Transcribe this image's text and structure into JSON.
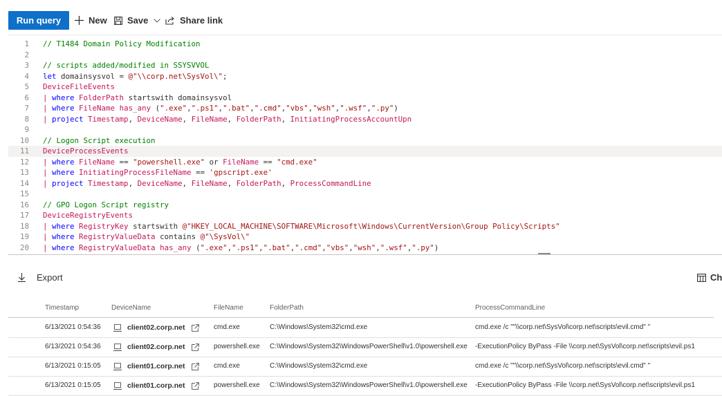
{
  "toolbar": {
    "run_label": "Run query",
    "new_label": "New",
    "save_label": "Save",
    "share_label": "Share link"
  },
  "editor": {
    "lines": [
      {
        "n": "1",
        "tokens": [
          [
            "c",
            "// T1484 Domain Policy Modification"
          ]
        ]
      },
      {
        "n": "2",
        "tokens": []
      },
      {
        "n": "3",
        "tokens": [
          [
            "c",
            "// scripts added/modified in SSYSVVOL"
          ]
        ]
      },
      {
        "n": "4",
        "tokens": [
          [
            "k",
            "let"
          ],
          [
            "o",
            " domainsysvol = "
          ],
          [
            "s",
            "@\"\\\\corp.net\\SysVol\\\""
          ],
          [
            "o",
            ";"
          ]
        ]
      },
      {
        "n": "5",
        "tokens": [
          [
            "t",
            "DeviceFileEvents"
          ]
        ]
      },
      {
        "n": "6",
        "tokens": [
          [
            "p",
            "| "
          ],
          [
            "k",
            "where"
          ],
          [
            "o",
            " "
          ],
          [
            "f",
            "FolderPath"
          ],
          [
            "o",
            " startswith domainsysvol"
          ]
        ]
      },
      {
        "n": "7",
        "tokens": [
          [
            "p",
            "| "
          ],
          [
            "k",
            "where"
          ],
          [
            "o",
            " "
          ],
          [
            "f",
            "FileName"
          ],
          [
            "o",
            " "
          ],
          [
            "f",
            "has_any"
          ],
          [
            "o",
            " ("
          ],
          [
            "s",
            "\".exe\""
          ],
          [
            "o",
            ","
          ],
          [
            "s",
            "\".ps1\""
          ],
          [
            "o",
            ","
          ],
          [
            "s",
            "\".bat\""
          ],
          [
            "o",
            ","
          ],
          [
            "s",
            "\".cmd\""
          ],
          [
            "o",
            ","
          ],
          [
            "s",
            "\"vbs\""
          ],
          [
            "o",
            ","
          ],
          [
            "s",
            "\"wsh\""
          ],
          [
            "o",
            ","
          ],
          [
            "s",
            "\".wsf\""
          ],
          [
            "o",
            ","
          ],
          [
            "s",
            "\".py\""
          ],
          [
            "o",
            ")"
          ]
        ]
      },
      {
        "n": "8",
        "tokens": [
          [
            "p",
            "| "
          ],
          [
            "k",
            "project"
          ],
          [
            "o",
            " "
          ],
          [
            "f",
            "Timestamp"
          ],
          [
            "o",
            ", "
          ],
          [
            "f",
            "DeviceName"
          ],
          [
            "o",
            ", "
          ],
          [
            "f",
            "FileName"
          ],
          [
            "o",
            ", "
          ],
          [
            "f",
            "FolderPath"
          ],
          [
            "o",
            ", "
          ],
          [
            "f",
            "InitiatingProcessAccountUpn"
          ]
        ]
      },
      {
        "n": "9",
        "tokens": []
      },
      {
        "n": "10",
        "tokens": [
          [
            "c",
            "// Logon Script execution"
          ]
        ]
      },
      {
        "n": "11",
        "tokens": [
          [
            "t",
            "DeviceProcessEvents"
          ]
        ],
        "hl": true
      },
      {
        "n": "12",
        "tokens": [
          [
            "p",
            "| "
          ],
          [
            "k",
            "where"
          ],
          [
            "o",
            " "
          ],
          [
            "f",
            "FileName"
          ],
          [
            "o",
            " == "
          ],
          [
            "s",
            "\"powershell.exe\""
          ],
          [
            "o",
            " or "
          ],
          [
            "f",
            "FileName"
          ],
          [
            "o",
            " == "
          ],
          [
            "s",
            "\"cmd.exe\""
          ]
        ]
      },
      {
        "n": "13",
        "tokens": [
          [
            "p",
            "| "
          ],
          [
            "k",
            "where"
          ],
          [
            "o",
            " "
          ],
          [
            "f",
            "InitiatingProcessFileName"
          ],
          [
            "o",
            " == "
          ],
          [
            "s",
            "'gpscript.exe'"
          ]
        ]
      },
      {
        "n": "14",
        "tokens": [
          [
            "p",
            "| "
          ],
          [
            "k",
            "project"
          ],
          [
            "o",
            " "
          ],
          [
            "f",
            "Timestamp"
          ],
          [
            "o",
            ", "
          ],
          [
            "f",
            "DeviceName"
          ],
          [
            "o",
            ", "
          ],
          [
            "f",
            "FileName"
          ],
          [
            "o",
            ", "
          ],
          [
            "f",
            "FolderPath"
          ],
          [
            "o",
            ", "
          ],
          [
            "f",
            "ProcessCommandLine"
          ]
        ]
      },
      {
        "n": "15",
        "tokens": []
      },
      {
        "n": "16",
        "tokens": [
          [
            "c",
            "// GPO Logon Script registry"
          ]
        ]
      },
      {
        "n": "17",
        "tokens": [
          [
            "t",
            "DeviceRegistryEvents"
          ]
        ]
      },
      {
        "n": "18",
        "tokens": [
          [
            "p",
            "| "
          ],
          [
            "k",
            "where"
          ],
          [
            "o",
            " "
          ],
          [
            "f",
            "RegistryKey"
          ],
          [
            "o",
            " startswith "
          ],
          [
            "s",
            "@\"HKEY_LOCAL_MACHINE\\SOFTWARE\\Microsoft\\Windows\\CurrentVersion\\Group Policy\\Scripts\""
          ]
        ]
      },
      {
        "n": "19",
        "tokens": [
          [
            "p",
            "| "
          ],
          [
            "k",
            "where"
          ],
          [
            "o",
            " "
          ],
          [
            "f",
            "RegistryValueData"
          ],
          [
            "o",
            " contains "
          ],
          [
            "s",
            "@\"\\SysVol\\\""
          ]
        ]
      },
      {
        "n": "20",
        "tokens": [
          [
            "p",
            "| "
          ],
          [
            "k",
            "where"
          ],
          [
            "o",
            " "
          ],
          [
            "f",
            "RegistryValueData"
          ],
          [
            "o",
            " "
          ],
          [
            "f",
            "has_any"
          ],
          [
            "o",
            " ("
          ],
          [
            "s",
            "\".exe\""
          ],
          [
            "o",
            ","
          ],
          [
            "s",
            "\".ps1\""
          ],
          [
            "o",
            ","
          ],
          [
            "s",
            "\".bat\""
          ],
          [
            "o",
            ","
          ],
          [
            "s",
            "\".cmd\""
          ],
          [
            "o",
            ","
          ],
          [
            "s",
            "\"vbs\""
          ],
          [
            "o",
            ","
          ],
          [
            "s",
            "\"wsh\""
          ],
          [
            "o",
            ","
          ],
          [
            "s",
            "\".wsf\""
          ],
          [
            "o",
            ","
          ],
          [
            "s",
            "\".py\""
          ],
          [
            "o",
            ")"
          ]
        ]
      }
    ]
  },
  "results": {
    "export_label": "Export",
    "chart_label": "Ch",
    "columns": [
      "Timestamp",
      "DeviceName",
      "FileName",
      "FolderPath",
      "ProcessCommandLine"
    ],
    "rows": [
      {
        "ts": "6/13/2021 0:54:36",
        "dev": "client02.corp.net",
        "file": "cmd.exe",
        "folder": "C:\\Windows\\System32\\cmd.exe",
        "cmd": "cmd.exe /c \"\"\\\\corp.net\\SysVol\\corp.net\\scripts\\evil.cmd\" \""
      },
      {
        "ts": "6/13/2021 0:54:36",
        "dev": "client02.corp.net",
        "file": "powershell.exe",
        "folder": "C:\\Windows\\System32\\WindowsPowerShell\\v1.0\\powershell.exe",
        "cmd": "-ExecutionPolicy ByPass -File \\\\corp.net\\SysVol\\corp.net\\scripts\\evil.ps1"
      },
      {
        "ts": "6/13/2021 0:15:05",
        "dev": "client01.corp.net",
        "file": "cmd.exe",
        "folder": "C:\\Windows\\System32\\cmd.exe",
        "cmd": "cmd.exe /c \"\"\\\\corp.net\\SysVol\\corp.net\\scripts\\evil.cmd\" \""
      },
      {
        "ts": "6/13/2021 0:15:05",
        "dev": "client01.corp.net",
        "file": "powershell.exe",
        "folder": "C:\\Windows\\System32\\WindowsPowerShell\\v1.0\\powershell.exe",
        "cmd": "-ExecutionPolicy ByPass -File \\\\corp.net\\SysVol\\corp.net\\scripts\\evil.ps1"
      }
    ]
  }
}
